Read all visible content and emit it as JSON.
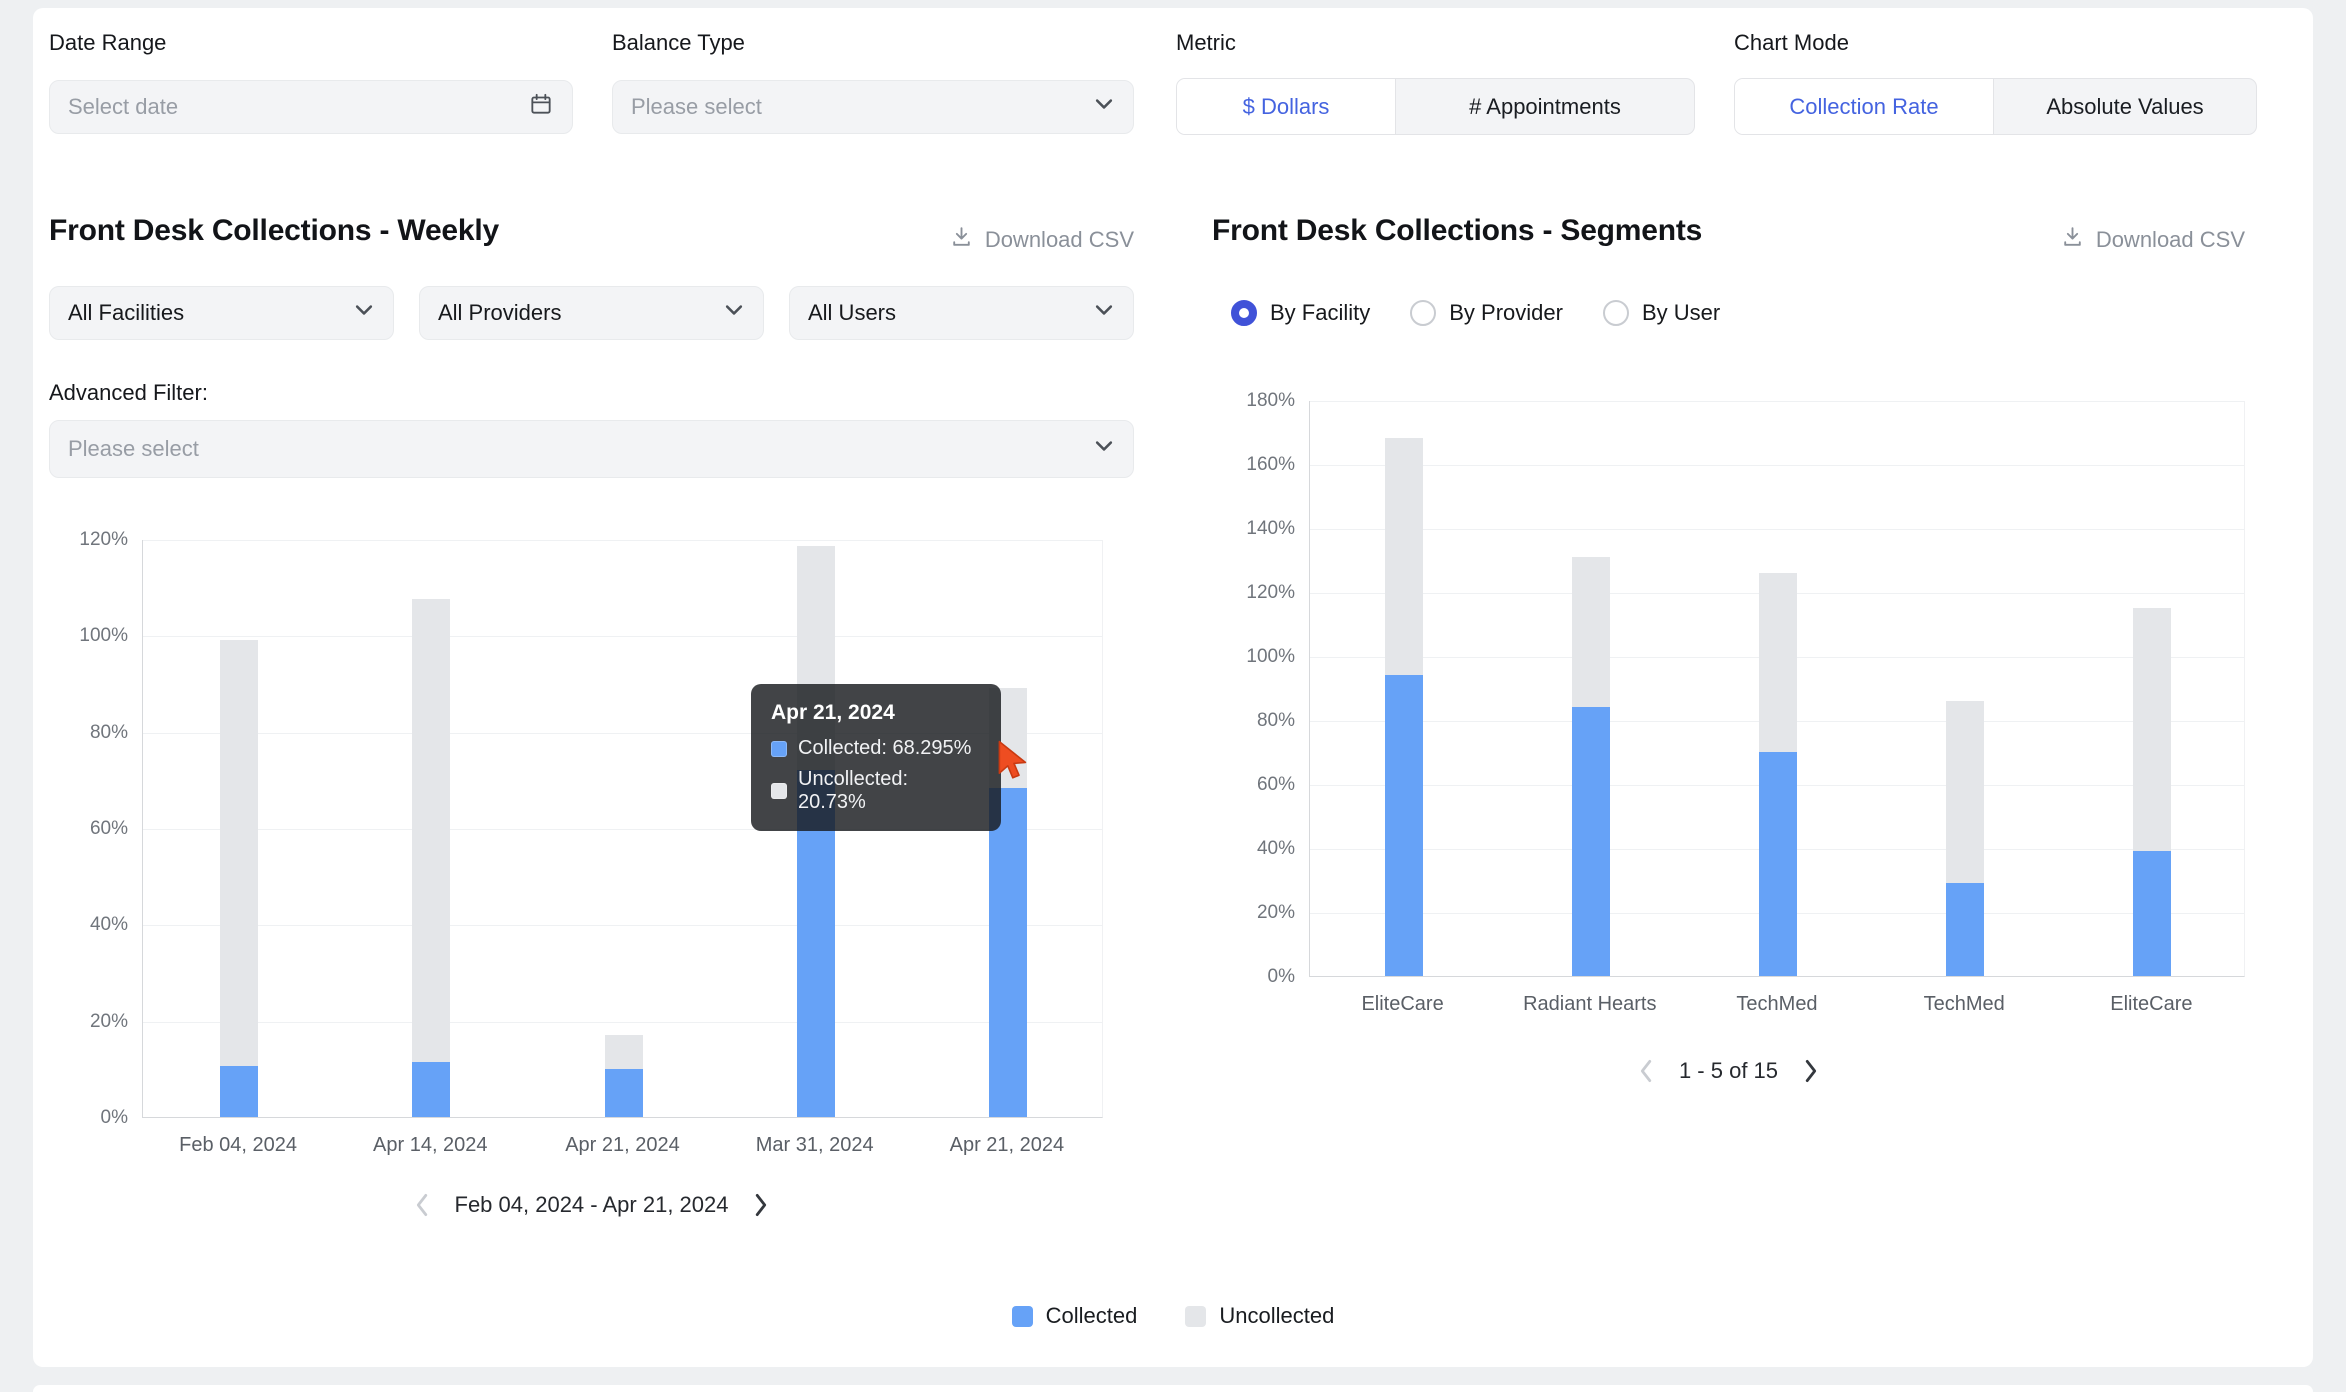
{
  "colors": {
    "accent_text": "#4463e0",
    "radio_selected": "#4052d8",
    "bar_collected": "#66a2f7",
    "bar_uncollected": "#e4e6e9",
    "tooltip_bg": "#191b1f"
  },
  "filters": {
    "date_range": {
      "label": "Date Range",
      "placeholder": "Select date"
    },
    "balance_type": {
      "label": "Balance Type",
      "placeholder": "Please select"
    },
    "metric": {
      "label": "Metric",
      "options": [
        "$ Dollars",
        "# Appointments"
      ],
      "selected": "$ Dollars"
    },
    "chart_mode": {
      "label": "Chart Mode",
      "options": [
        "Collection Rate",
        "Absolute Values"
      ],
      "selected": "Collection Rate"
    }
  },
  "weekly_panel": {
    "title": "Front Desk Collections - Weekly",
    "download_csv": "Download CSV",
    "filter_dropdowns": [
      "All Facilities",
      "All Providers",
      "All Users"
    ],
    "advanced_filter_label": "Advanced Filter:",
    "advanced_filter_placeholder": "Please select",
    "pagination": {
      "label": "Feb 04, 2024 - Apr 21, 2024"
    },
    "tooltip": {
      "title": "Apr 21, 2024",
      "rows": [
        {
          "label": "Collected: 68.295%",
          "color": "#66a2f7"
        },
        {
          "label": "Uncollected: 20.73%",
          "color": "#e4e6e9"
        }
      ]
    }
  },
  "segments_panel": {
    "title": "Front Desk Collections - Segments",
    "download_csv": "Download CSV",
    "radios": [
      {
        "label": "By Facility",
        "selected": true
      },
      {
        "label": "By Provider",
        "selected": false
      },
      {
        "label": "By User",
        "selected": false
      }
    ],
    "pagination": {
      "label": "1 - 5 of 15"
    }
  },
  "legend": [
    {
      "label": "Collected",
      "color": "#66a2f7"
    },
    {
      "label": "Uncollected",
      "color": "#e4e6e9"
    }
  ],
  "chart_data": [
    {
      "id": "weekly",
      "type": "bar",
      "stacked": true,
      "title": "Front Desk Collections - Weekly",
      "categories": [
        "Feb 04, 2024",
        "Apr 14, 2024",
        "Apr 21, 2024",
        "Mar 31, 2024",
        "Apr 21, 2024"
      ],
      "series": [
        {
          "name": "Collected",
          "color": "#66a2f7",
          "values": [
            10.5,
            11.5,
            10,
            72,
            68.295
          ]
        },
        {
          "name": "Uncollected",
          "color": "#e4e6e9",
          "values": [
            88.5,
            96,
            7,
            46.5,
            20.73
          ]
        }
      ],
      "ylim": [
        0,
        120
      ],
      "ytick_step": 20,
      "ytick_suffix": "%",
      "grid": true,
      "legend_position": "bottom",
      "hovered_bar": "Apr 21, 2024"
    },
    {
      "id": "segments",
      "type": "bar",
      "stacked": true,
      "title": "Front Desk Collections - Segments",
      "categories": [
        "EliteCare",
        "Radiant Hearts",
        "TechMed",
        "TechMed",
        "EliteCare"
      ],
      "series": [
        {
          "name": "Collected",
          "color": "#66a2f7",
          "values": [
            94,
            84,
            70,
            29,
            39
          ]
        },
        {
          "name": "Uncollected",
          "color": "#e4e6e9",
          "values": [
            74,
            47,
            56,
            57,
            76
          ]
        }
      ],
      "ylim": [
        0,
        180
      ],
      "ytick_step": 20,
      "ytick_suffix": "%",
      "grid": true
    }
  ]
}
